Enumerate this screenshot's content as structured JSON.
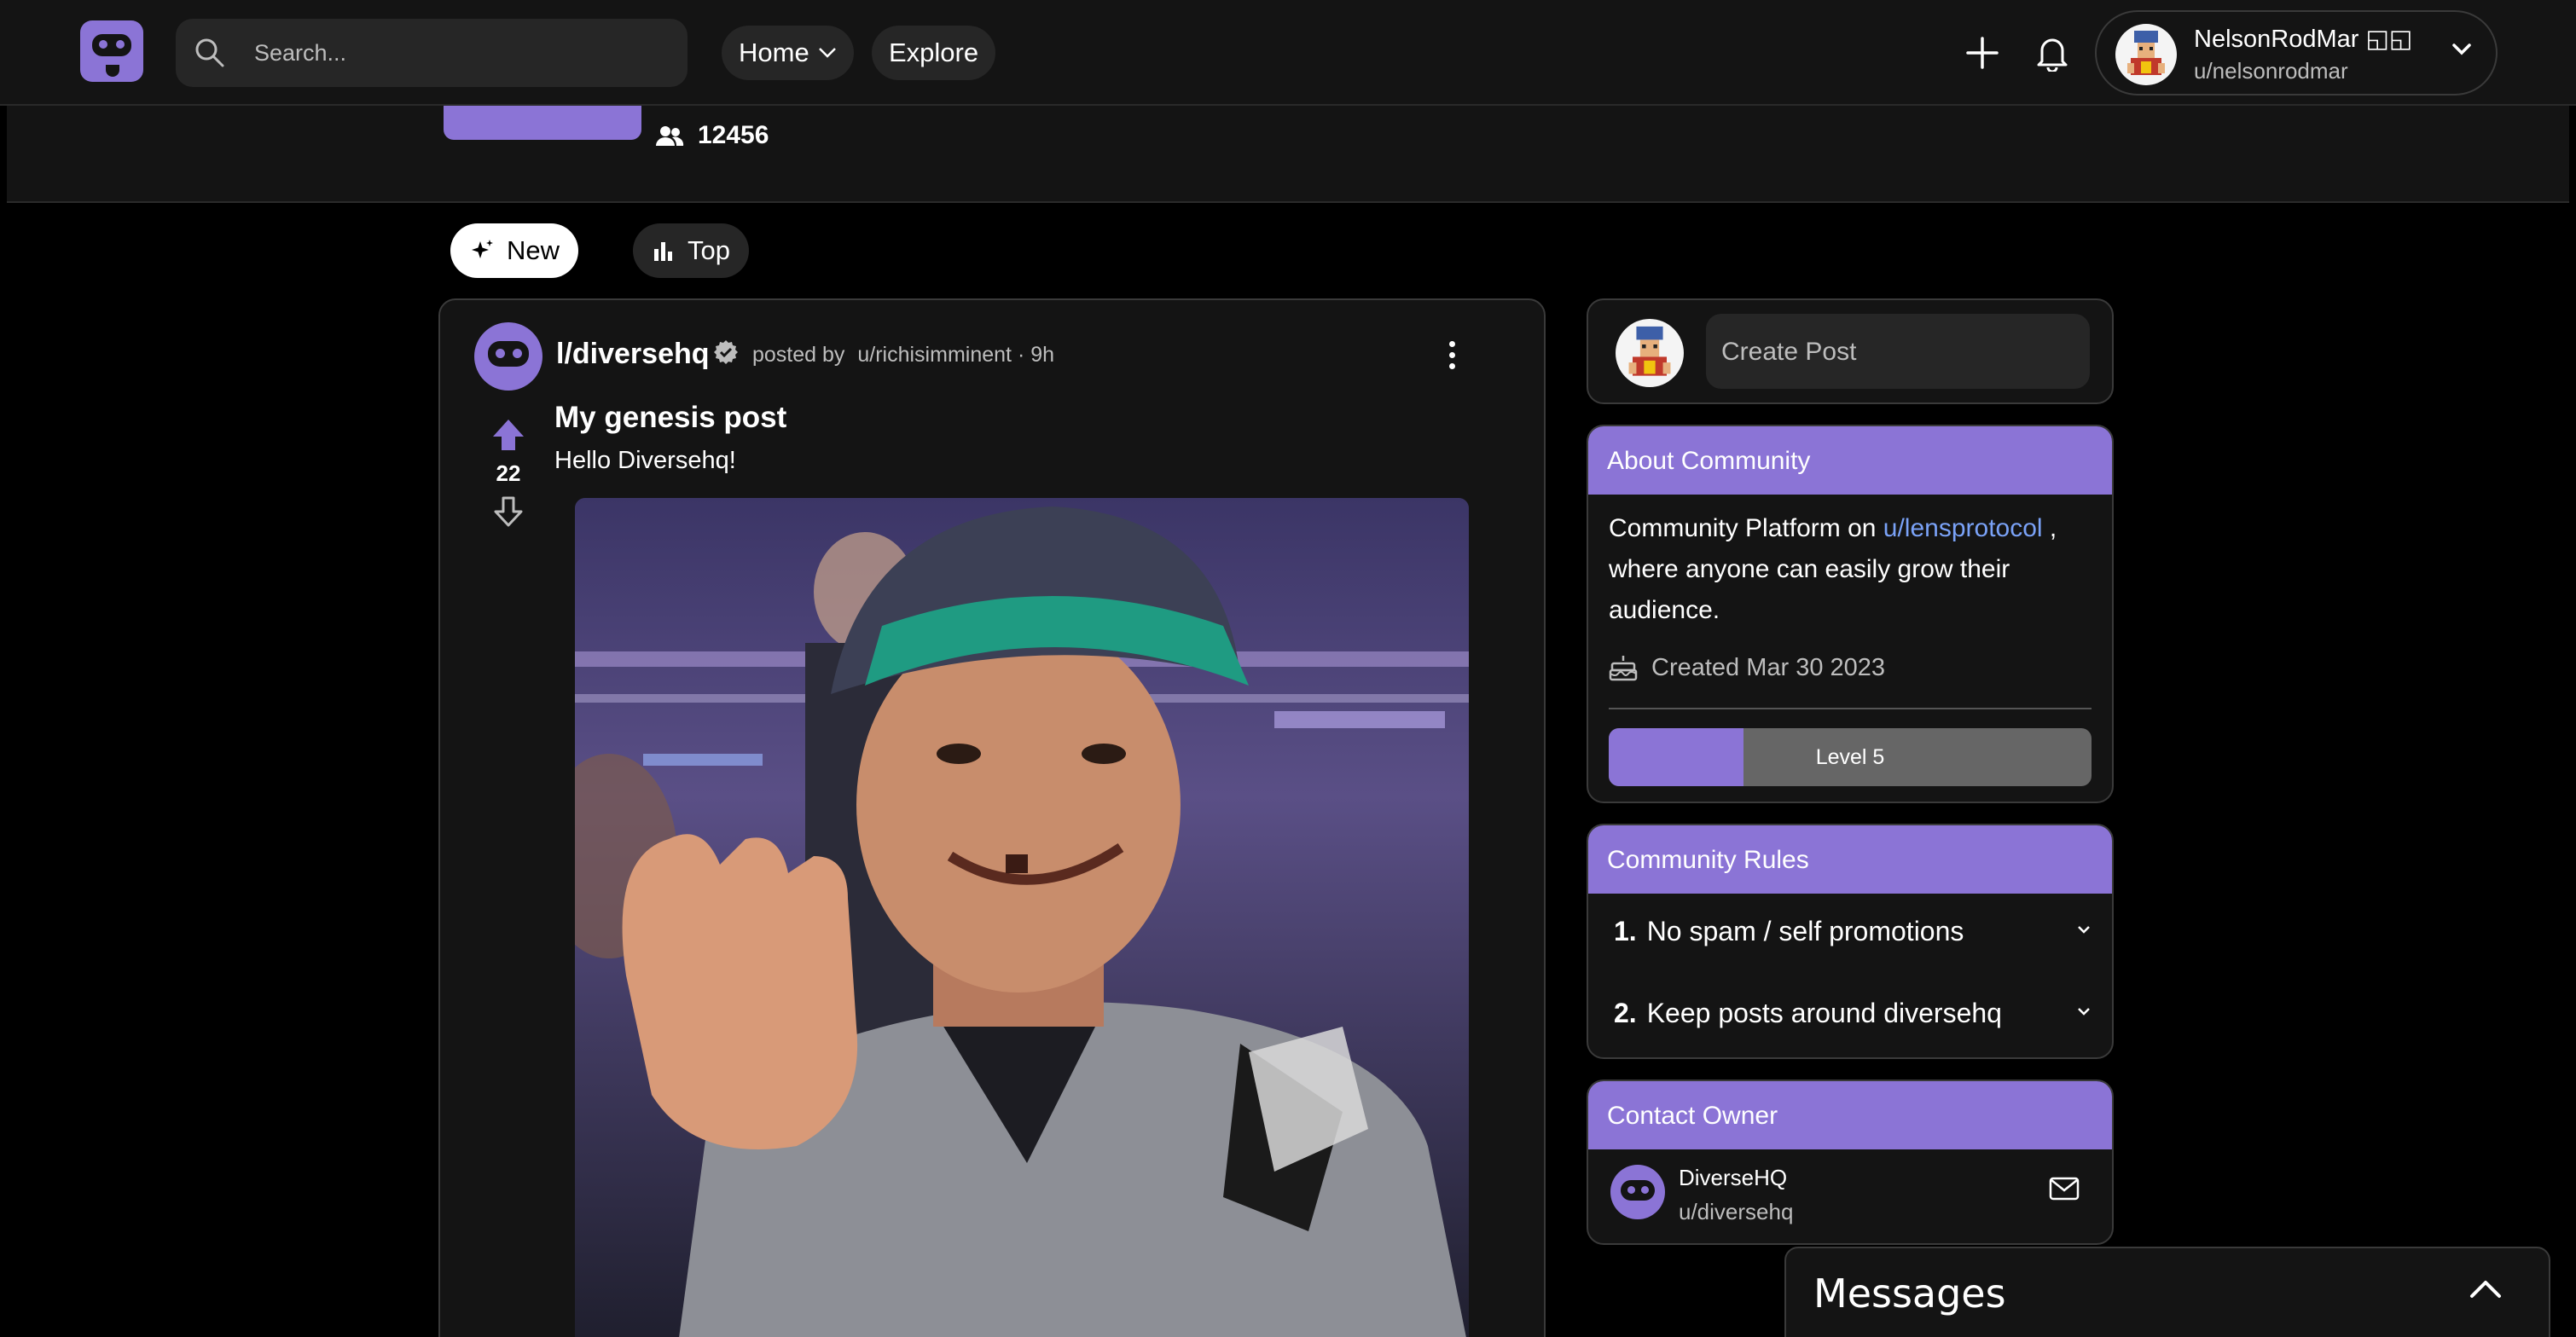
{
  "nav": {
    "search_placeholder": "Search...",
    "home_label": "Home",
    "explore_label": "Explore"
  },
  "user": {
    "display_name": "NelsonRodMar",
    "name_suffix": "◱◱",
    "handle": "u/nelsonrodmar"
  },
  "community": {
    "member_count": "12456"
  },
  "sort": {
    "new_label": "New",
    "top_label": "Top"
  },
  "post": {
    "community": "l/diversehq",
    "posted_by_prefix": "posted by",
    "author": "u/richisimminent",
    "age": "· 9h",
    "votes": "22",
    "title": "My genesis post",
    "body": "Hello Diversehq!"
  },
  "sidebar": {
    "create_placeholder": "Create Post",
    "about": {
      "heading": "About Community",
      "text_prefix": "Community Platform on",
      "link": "u/lensprotocol",
      "text_suffix": ", where anyone can easily grow their audience.",
      "created": "Created Mar 30 2023",
      "level_label": "Level 5",
      "level_progress": 0.28
    },
    "rules": {
      "heading": "Community Rules",
      "items": [
        {
          "num": "1.",
          "text": "No spam / self promotions"
        },
        {
          "num": "2.",
          "text": "Keep posts around diversehq"
        }
      ]
    },
    "contact": {
      "heading": "Contact Owner",
      "name": "DiverseHQ",
      "handle": "u/diversehq"
    }
  },
  "messages": {
    "title": "Messages"
  },
  "colors": {
    "accent": "#8b74d6",
    "link": "#7aa2f7",
    "surface": "#141414",
    "background": "#000000"
  }
}
